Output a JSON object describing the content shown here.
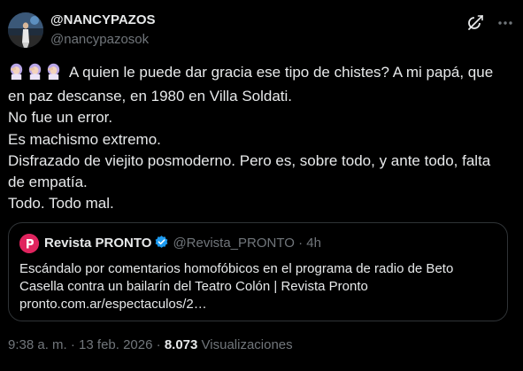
{
  "author": {
    "display_name": "@NANCYPAZOS",
    "handle": "@nancypazosok",
    "avatar": "avatar"
  },
  "icons": {
    "grok": "grok-icon",
    "more": "more-options-icon",
    "emoji": "woman-facepalming-emoji",
    "verified": "verified-badge-icon",
    "quote_avatar": "pronto-logo"
  },
  "tweet": {
    "lines": [
      "A quien le puede dar gracia ese tipo de chistes?  A mi papá, que",
      "en paz descanse, en 1980 en Villa Soldati.",
      "No fue un error.",
      "Es machismo extremo.",
      "Disfrazado de viejito posmoderno. Pero es, sobre todo, y ante todo, falta",
      "de empatía.",
      "Todo. Todo mal."
    ]
  },
  "quote": {
    "name": "Revista PRONTO",
    "handle": "@Revista_PRONTO",
    "separator": "·",
    "time": "4h",
    "lines": [
      "Escándalo por comentarios homofóbicos en el programa de radio de Beto",
      "Casella contra un bailarín del Teatro Colón | Revista Pronto",
      "pronto.com.ar/espectaculos/2…"
    ]
  },
  "meta": {
    "time": "9:38 a. m.",
    "sep": "·",
    "date": "13 feb. 2026",
    "views_count": "8.073",
    "views_label": "Visualizaciones"
  },
  "colors": {
    "background": "#000000",
    "text": "#e7e9ea",
    "secondary": "#71767b",
    "border": "#2f3336",
    "verified": "#1d9bf0",
    "pronto": "#e0245e"
  }
}
